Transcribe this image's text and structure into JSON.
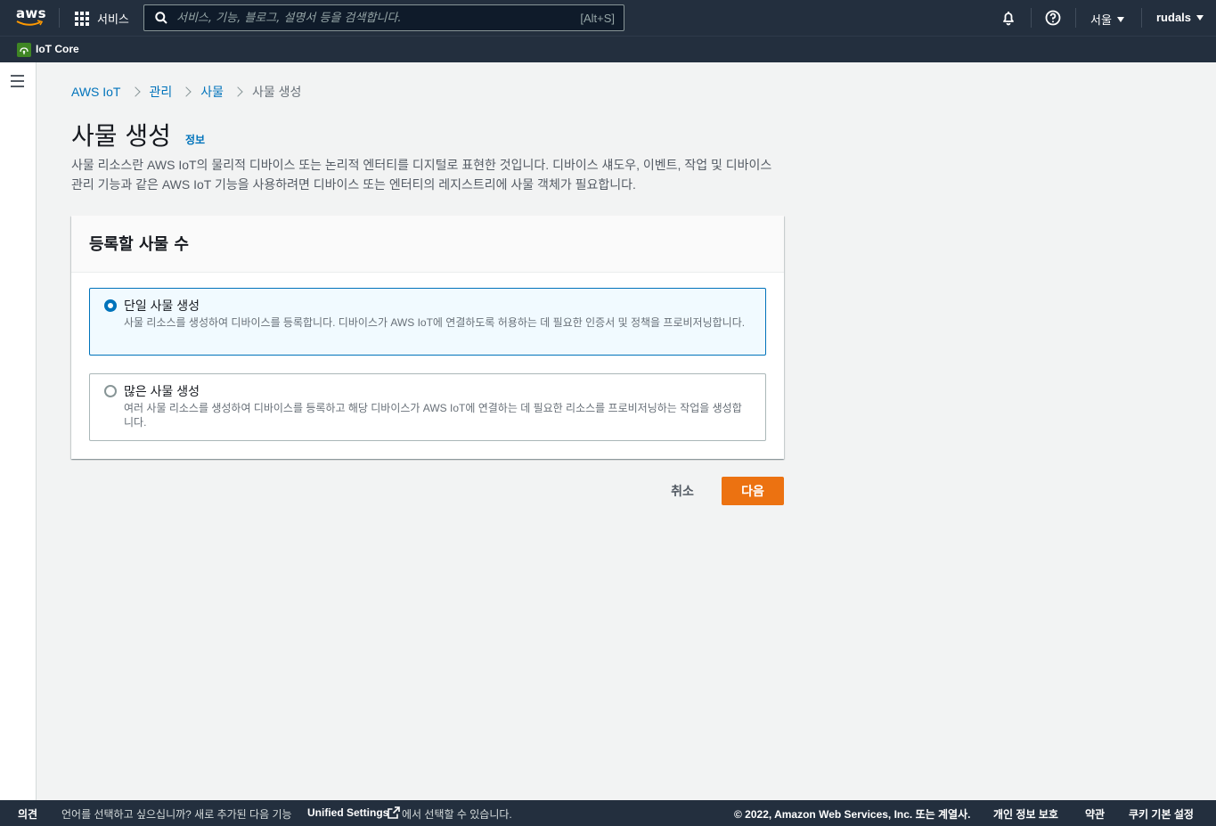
{
  "topnav": {
    "logo_text": "aws",
    "services_label": "서비스",
    "search_placeholder": "서비스, 기능, 블로그, 설명서 등을 검색합니다.",
    "search_shortcut": "[Alt+S]",
    "region": "서울",
    "user": "rudals"
  },
  "subnav": {
    "service_name": "IoT Core"
  },
  "breadcrumb": {
    "items": [
      "AWS IoT",
      "관리",
      "사물",
      "사물 생성"
    ]
  },
  "page": {
    "title": "사물 생성",
    "info_link": "정보",
    "description": "사물 리소스란 AWS IoT의 물리적 디바이스 또는 논리적 엔터티를 디지털로 표현한 것입니다. 디바이스 섀도우, 이벤트, 작업 및 디바이스 관리 기능과 같은 AWS IoT 기능을 사용하려면 디바이스 또는 엔터티의 레지스트리에 사물 객체가 필요합니다."
  },
  "panel": {
    "header": "등록할 사물 수",
    "options": [
      {
        "title": "단일 사물 생성",
        "description": "사물 리소스를 생성하여 디바이스를 등록합니다. 디바이스가 AWS IoT에 연결하도록 허용하는 데 필요한 인증서 및 정책을 프로비저닝합니다.",
        "selected": true
      },
      {
        "title": "많은 사물 생성",
        "description": "여러 사물 리소스를 생성하여 디바이스를 등록하고 해당 디바이스가 AWS IoT에 연결하는 데 필요한 리소스를 프로비저닝하는 작업을 생성합니다.",
        "selected": false
      }
    ]
  },
  "actions": {
    "cancel": "취소",
    "next": "다음"
  },
  "footer": {
    "feedback": "의견",
    "language_prefix": "언어를 선택하고 싶으십니까? 새로 추가된 다음 기능",
    "unified_settings": "Unified Settings",
    "language_suffix": "에서 선택할 수 있습니다.",
    "copyright": "© 2022, Amazon Web Services, Inc. 또는 계열사.",
    "privacy": "개인 정보 보호",
    "terms": "약관",
    "cookies": "쿠키 기본 설정"
  },
  "colors": {
    "nav_bg": "#232f3e",
    "link": "#0073bb",
    "primary_button": "#ec7211",
    "page_bg": "#f2f3f3",
    "iot_badge": "#3f8624"
  }
}
